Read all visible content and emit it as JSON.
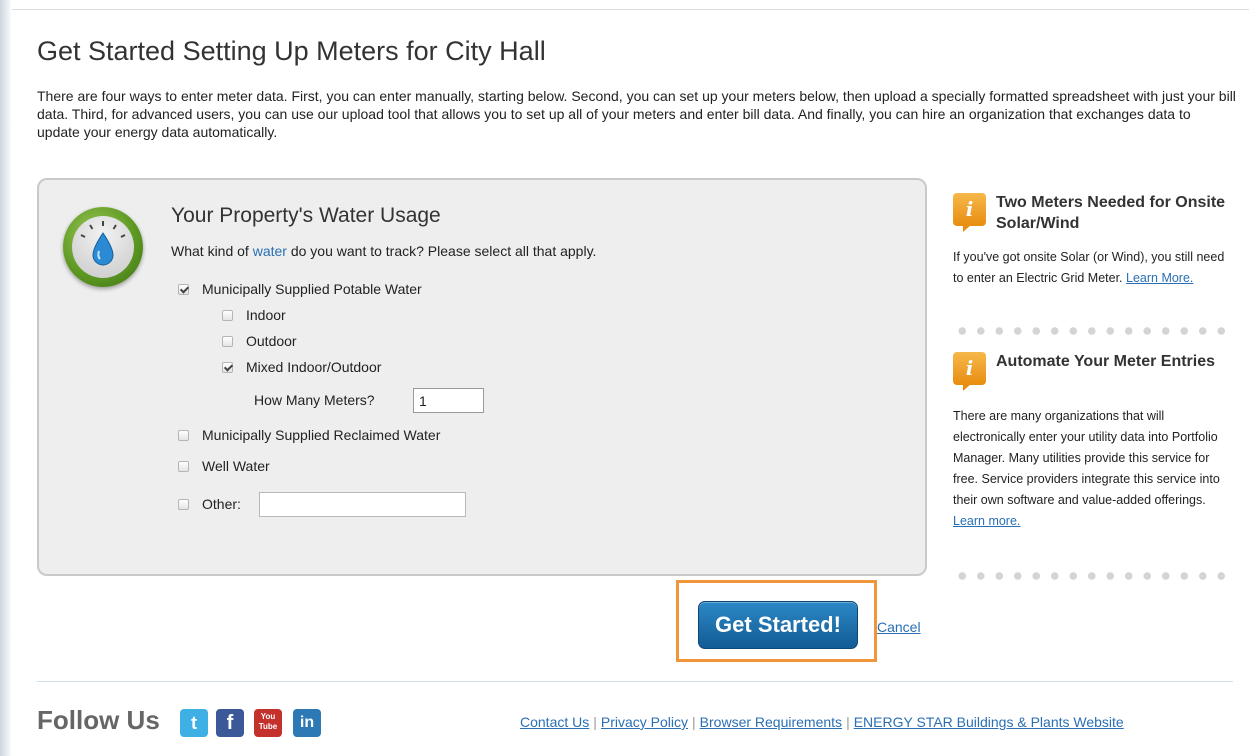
{
  "page": {
    "title": "Get Started Setting Up Meters for City Hall",
    "intro": "There are four ways to enter meter data. First, you can enter manually, starting below. Second, you can set up your meters below, then upload a specially formatted spreadsheet with just your bill data. Third, for advanced users, you can use our upload tool that allows you to set up all of your meters and enter bill data. And finally, you can hire an organization that exchanges data to update your energy data automatically."
  },
  "panel": {
    "heading": "Your Property's Water Usage",
    "question_prefix": "What kind of",
    "question_link": "water",
    "question_suffix": "do you want to track? Please select all that apply.",
    "options": {
      "potable": {
        "label": "Municipally Supplied Potable Water",
        "checked": true
      },
      "indoor": {
        "label": "Indoor",
        "checked": false
      },
      "outdoor": {
        "label": "Outdoor",
        "checked": false
      },
      "mixed": {
        "label": "Mixed Indoor/Outdoor",
        "checked": true
      },
      "reclaimed": {
        "label": "Municipally Supplied Reclaimed Water",
        "checked": false
      },
      "well": {
        "label": "Well Water",
        "checked": false
      },
      "other": {
        "label": "Other:",
        "checked": false,
        "value": ""
      }
    },
    "meters_label": "How Many Meters?",
    "meters_value": "1"
  },
  "sidebar": {
    "box1": {
      "title": "Two Meters Needed for Onsite Solar/Wind",
      "text": "If you've got onsite Solar (or Wind), you still need to enter an Electric Grid Meter.",
      "link": "Learn More."
    },
    "box2": {
      "title": "Automate Your Meter Entries",
      "text": "There are many organizations that will electronically enter your utility data into Portfolio Manager. Many utilities provide this service for free. Service providers integrate this service into their own software and value-added offerings.",
      "link": "Learn more."
    },
    "info_icon_glyph": "i"
  },
  "actions": {
    "start_label": "Get Started!",
    "cancel_label": "Cancel"
  },
  "footer": {
    "follow_label": "Follow Us",
    "social": [
      {
        "name": "twitter-icon",
        "glyph": "t",
        "color": "#3fb0e6"
      },
      {
        "name": "facebook-icon",
        "glyph": "f",
        "color": "#3b5998"
      },
      {
        "name": "youtube-icon",
        "glyph": "You Tube",
        "color": "#c4302b"
      },
      {
        "name": "linkedin-icon",
        "glyph": "in",
        "color": "#2c79b5"
      }
    ],
    "links": [
      "Contact Us",
      "Privacy Policy",
      "Browser Requirements",
      "ENERGY STAR Buildings & Plants Website"
    ]
  },
  "colors": {
    "accent": "#1b6ca8",
    "highlight": "#f0953a",
    "link": "#2a6fb5",
    "info": "#f0a020"
  }
}
